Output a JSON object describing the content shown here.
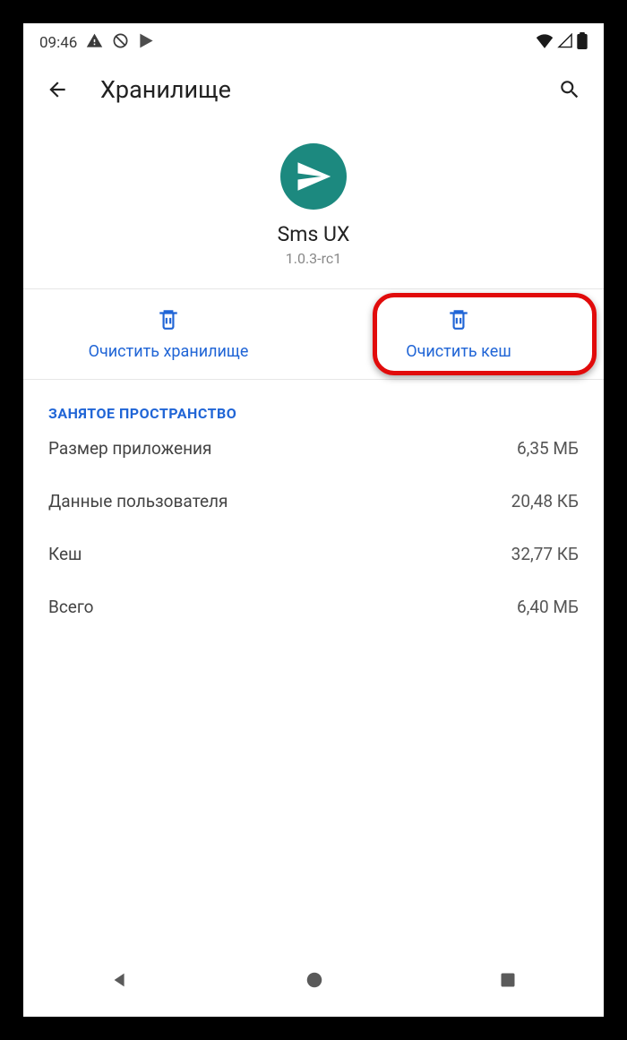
{
  "status_bar": {
    "time": "09:46"
  },
  "app_bar": {
    "title": "Хранилище"
  },
  "app": {
    "name": "Sms UX",
    "version": "1.0.3-rc1"
  },
  "actions": {
    "clear_storage": "Очистить хранилище",
    "clear_cache": "Очистить кеш"
  },
  "section_header": "ЗАНЯТОЕ ПРОСТРАНСТВО",
  "rows": {
    "app_size_label": "Размер приложения",
    "app_size_value": "6,35 МБ",
    "user_data_label": "Данные пользователя",
    "user_data_value": "20,48 КБ",
    "cache_label": "Кеш",
    "cache_value": "32,77 КБ",
    "total_label": "Всего",
    "total_value": "6,40 МБ"
  }
}
